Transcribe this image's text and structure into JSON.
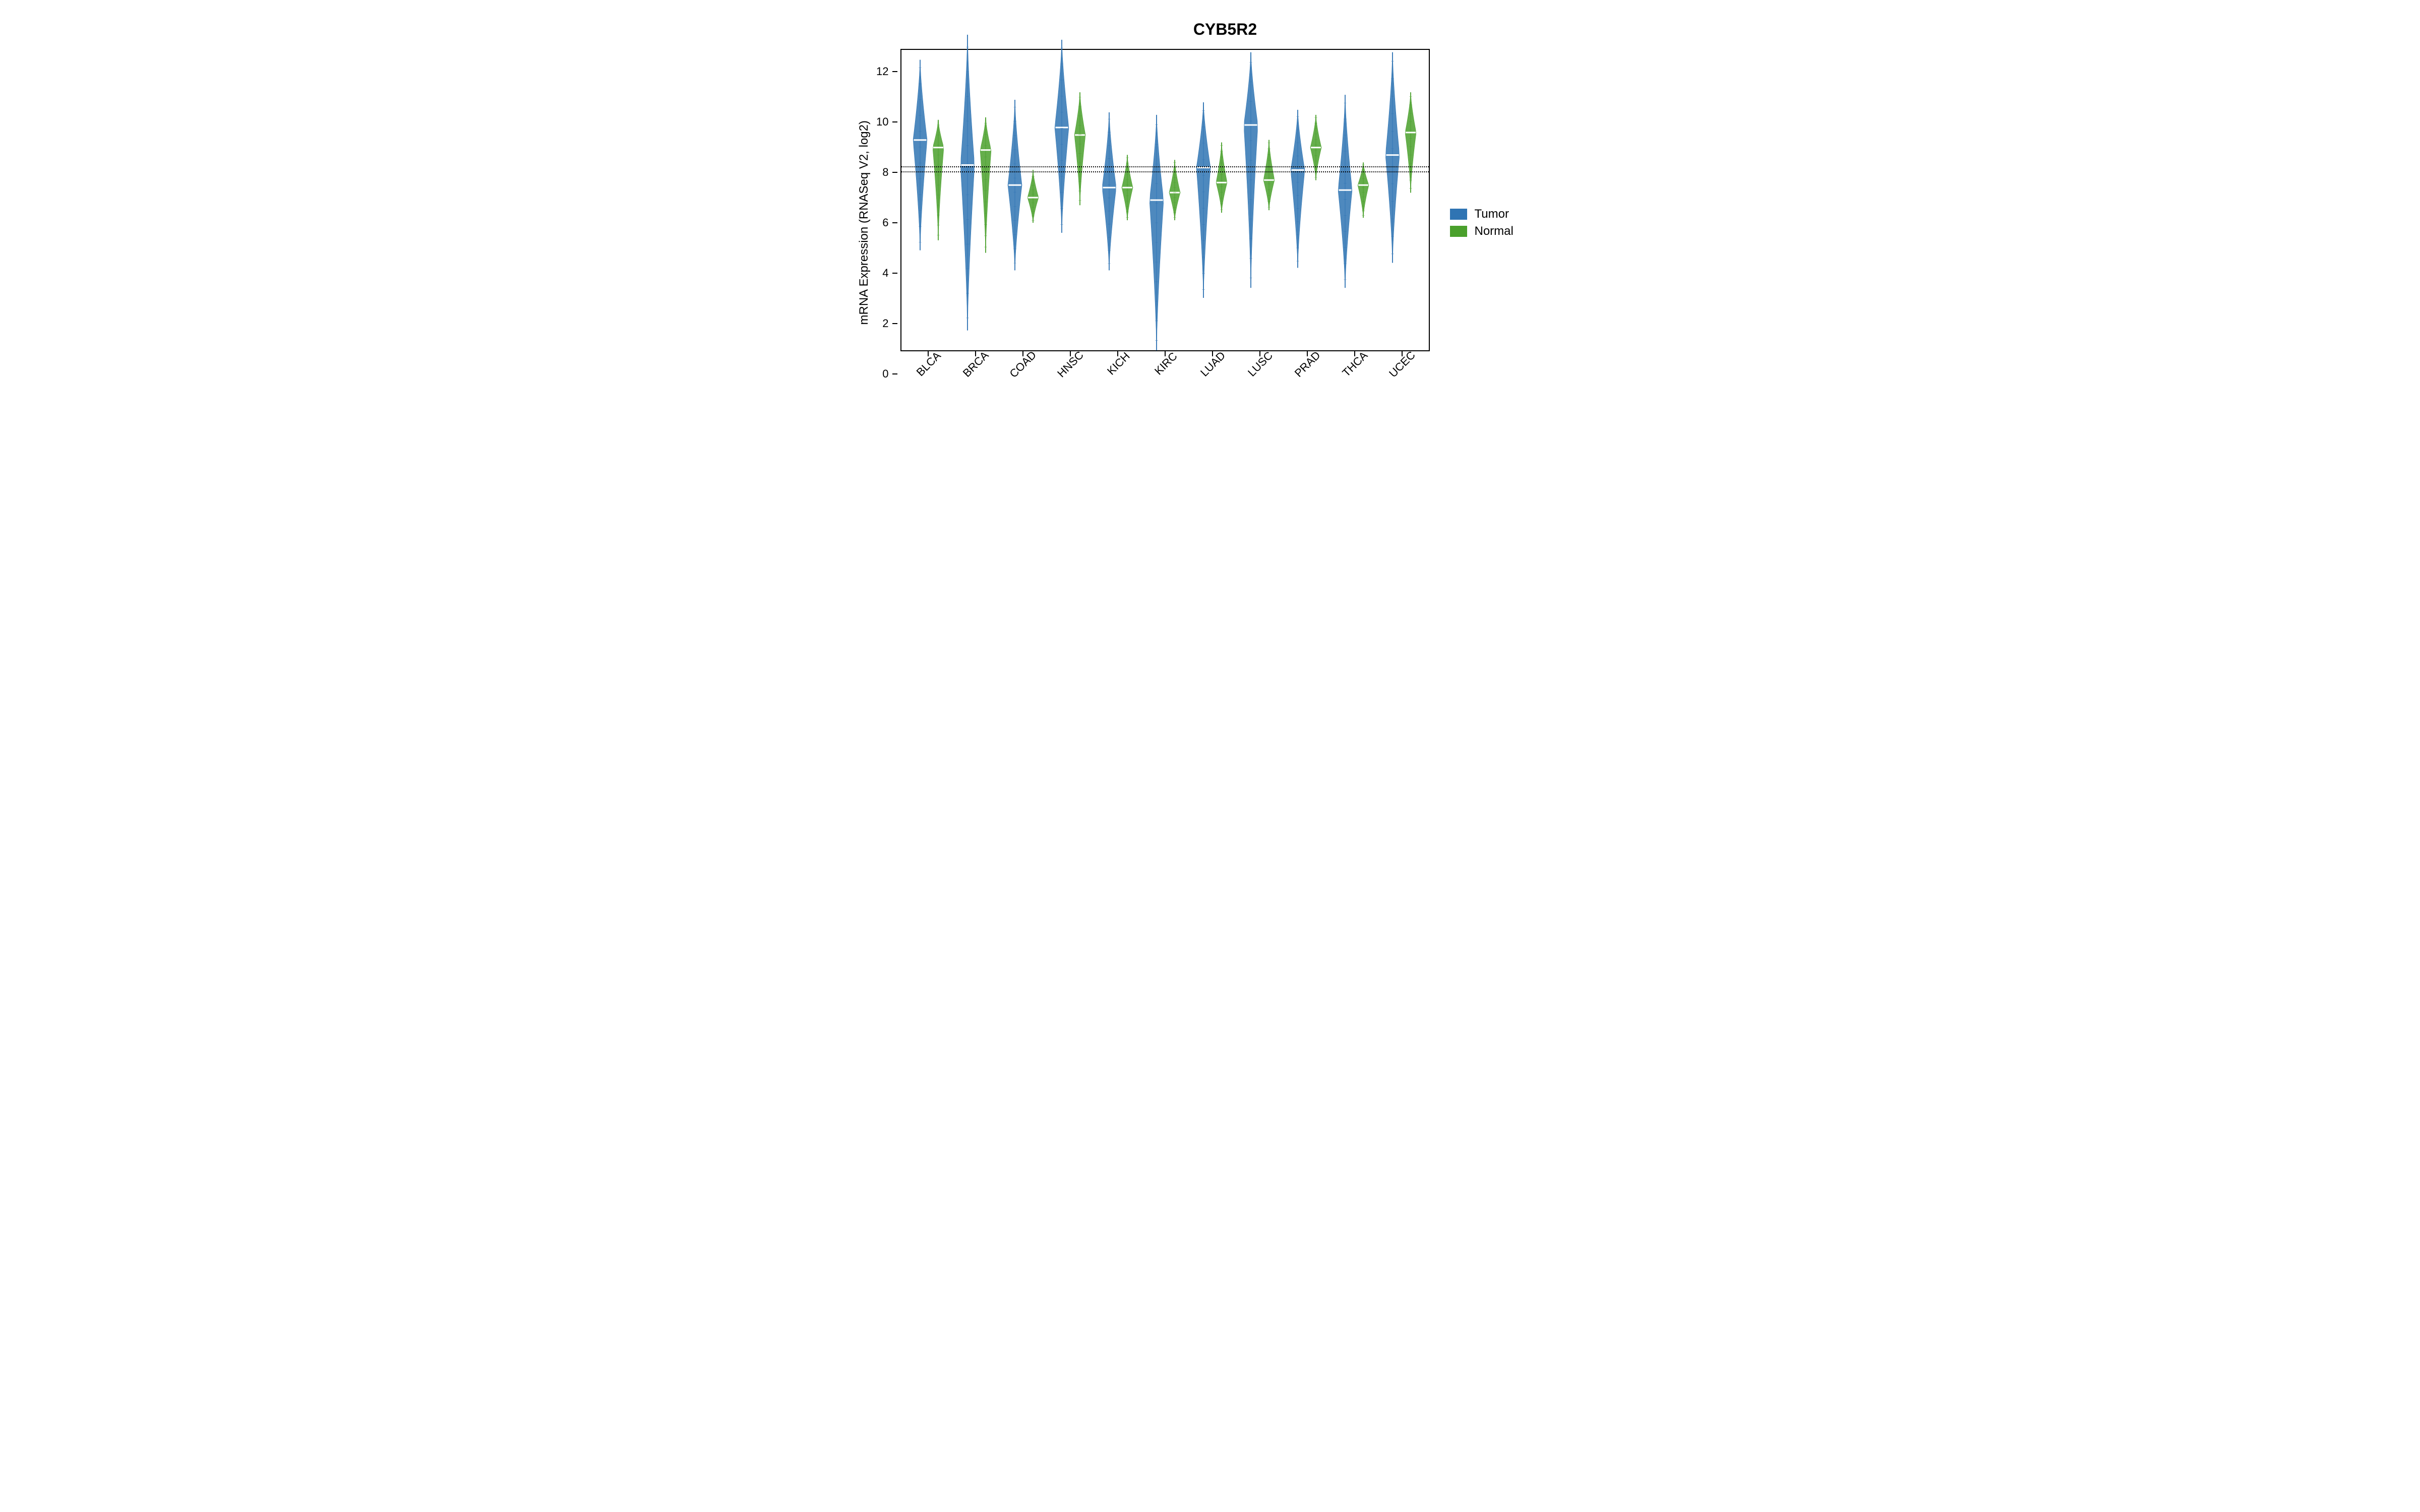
{
  "chart_data": {
    "type": "beanplot",
    "title": "CYB5R2",
    "ylabel": "mRNA Expression (RNASeq V2, log2)",
    "xlabel": "",
    "ylim": [
      0,
      12
    ],
    "yticks": [
      0,
      2,
      4,
      6,
      8,
      10,
      12
    ],
    "reference_lines": [
      7.15,
      7.35
    ],
    "categories": [
      "BLCA",
      "BRCA",
      "COAD",
      "HNSC",
      "KICH",
      "KIRC",
      "LUAD",
      "LUSC",
      "PRAD",
      "THCA",
      "UCEC"
    ],
    "series": [
      {
        "name": "Tumor",
        "color": "#2f74b3",
        "median": [
          8.4,
          7.4,
          6.6,
          8.9,
          6.5,
          6.0,
          7.3,
          9.0,
          7.2,
          6.4,
          7.8
        ],
        "range_low": [
          4.0,
          0.8,
          3.2,
          4.7,
          3.2,
          0.0,
          2.1,
          2.5,
          3.3,
          2.5,
          3.5
        ],
        "range_high": [
          11.6,
          12.6,
          10.0,
          12.4,
          9.5,
          9.4,
          9.9,
          11.9,
          9.6,
          10.2,
          11.9
        ]
      },
      {
        "name": "Normal",
        "color": "#4aa02c",
        "median": [
          8.1,
          8.0,
          6.1,
          8.6,
          6.5,
          6.3,
          6.7,
          6.8,
          8.1,
          6.6,
          8.7
        ],
        "range_low": [
          4.4,
          3.9,
          5.1,
          5.8,
          5.2,
          5.2,
          5.5,
          5.6,
          6.8,
          5.3,
          6.3
        ],
        "range_high": [
          9.2,
          9.3,
          7.2,
          10.3,
          7.8,
          7.6,
          8.3,
          8.4,
          9.4,
          7.5,
          10.3
        ]
      }
    ],
    "legend": {
      "position": "right",
      "entries": [
        {
          "label": "Tumor",
          "color": "#2f74b3"
        },
        {
          "label": "Normal",
          "color": "#4aa02c"
        }
      ]
    }
  }
}
